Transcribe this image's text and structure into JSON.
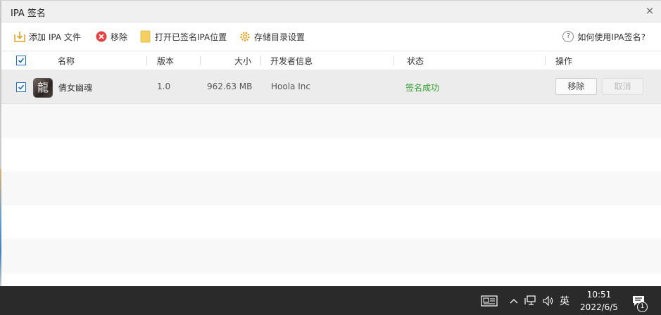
{
  "window": {
    "title": "IPA 签名",
    "close_glyph": "×"
  },
  "toolbar": {
    "add_label": "添加 IPA 文件",
    "remove_label": "移除",
    "open_folder_label": "打开已签名IPA位置",
    "storage_label": "存储目录设置",
    "help_label": "如何使用IPA签名?",
    "help_glyph": "?"
  },
  "table": {
    "columns": {
      "name": "名称",
      "version": "版本",
      "size": "大小",
      "developer": "开发者信息",
      "status": "状态",
      "actions": "操作"
    },
    "header_checked": true,
    "rows": [
      {
        "checked": true,
        "icon_glyph": "龍",
        "name": "倩女幽魂",
        "version": "1.0",
        "size": "962.63 MB",
        "developer": "Hoola Inc",
        "status": "签名成功",
        "remove_label": "移除",
        "cancel_label": "取消"
      }
    ]
  },
  "taskbar": {
    "input_method": "英",
    "time": "10:51",
    "date": "2022/6/5",
    "notification_count": "1"
  },
  "colors": {
    "status_success": "#2fa12f",
    "checkbox_accent": "#1a6fc9",
    "taskbar_bg": "#2a2a2a"
  }
}
